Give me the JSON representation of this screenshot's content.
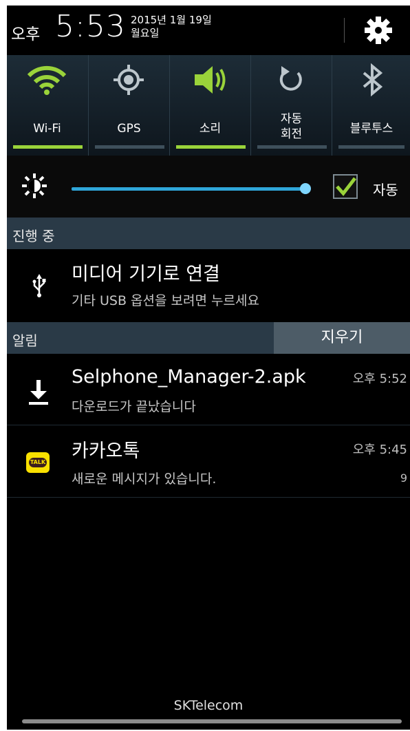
{
  "status": {
    "ampm": "오후",
    "time": "5:53",
    "date_line1": "2015년 1월 19일",
    "date_line2": "월요일"
  },
  "toggles": [
    {
      "label": "Wi-Fi",
      "icon": "wifi-icon",
      "active": true
    },
    {
      "label": "GPS",
      "icon": "gps-icon",
      "active": false
    },
    {
      "label": "소리",
      "icon": "sound-icon",
      "active": true
    },
    {
      "label_line1": "자동",
      "label_line2": "회전",
      "icon": "rotate-icon",
      "active": false
    },
    {
      "label": "블루투스",
      "icon": "bluetooth-icon",
      "active": false
    }
  ],
  "brightness": {
    "level": 0.98,
    "auto_label": "자동",
    "auto_checked": true
  },
  "ongoing": {
    "header": "진행 중",
    "title": "미디어 기기로 연결",
    "subtitle": "기타 USB 옵션을 보려면 누르세요",
    "icon": "usb-icon"
  },
  "notifications_section": {
    "header": "알림",
    "clear_label": "지우기"
  },
  "notifications": [
    {
      "title": "Selphone_Manager-2.apk",
      "subtitle": "다운로드가 끝났습니다",
      "time": "오후 5:52",
      "icon": "download-icon"
    },
    {
      "title": "카카오톡",
      "subtitle": "새로운 메시지가 있습니다.",
      "time": "오후 5:45",
      "count": "9",
      "icon": "kakaotalk-icon",
      "icon_text": "TALK"
    }
  ],
  "carrier": "SKTelecom",
  "colors": {
    "active": "#9ad33a",
    "slider": "#2fa6d9",
    "kakao": "#f9e000"
  }
}
